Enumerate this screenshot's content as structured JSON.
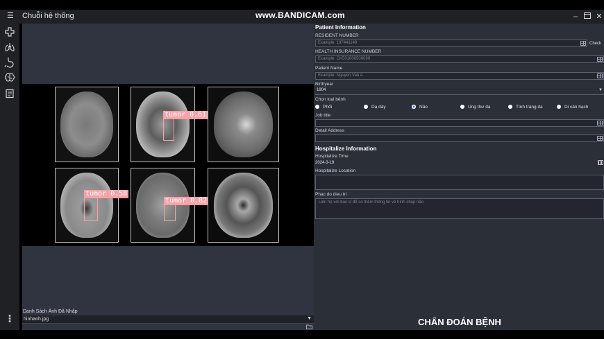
{
  "app": {
    "title": "Chuỗi hệ thống",
    "watermark": "www.BANDICAM.com",
    "window_controls": [
      "minimize",
      "maximize",
      "close"
    ]
  },
  "sidebar": {
    "icons": [
      "add-icon",
      "lungs-icon",
      "stomach-icon",
      "brain-icon",
      "document-icon"
    ],
    "more_icon": "more-vertical-icon"
  },
  "left_panel": {
    "detections": [
      {
        "label": "tumor  0.61"
      },
      {
        "label": "tumor  0.58"
      },
      {
        "label": "tumor  0.82"
      }
    ],
    "image_list_label": "Danh Sách Ảnh Đã Nhập",
    "selected_image": "hinhanh.jpg"
  },
  "patient_info": {
    "section_title": "Patient Information",
    "resident_number": {
      "label": "RESIDENT NUMBER",
      "placeholder": "Example: 197441149"
    },
    "check_label": "Check",
    "insurance_number": {
      "label": "HEALTH INSURANCE NUMBER",
      "placeholder": "Example: CK501000500099"
    },
    "patient_name": {
      "label": "Patient Name",
      "placeholder": "Example: Nguyen Van A"
    },
    "birthyear": {
      "label": "Birthyear",
      "value": "1904"
    },
    "disease_type": {
      "label": "Chọn loại bệnh",
      "options": [
        "Phổi",
        "Dạ dày",
        "Não",
        "Ung thư da",
        "Tình trạng da",
        "Di căn hạch"
      ],
      "selected": "Não"
    },
    "job_title": {
      "label": "Job title",
      "value": ""
    },
    "detail_address": {
      "label": "Detail Address",
      "value": ""
    }
  },
  "hospitalize_info": {
    "section_title": "Hospitalize Information",
    "time": {
      "label": "Hospitalize Time",
      "value": "2024-3-19"
    },
    "location": {
      "label": "Hospitalize Location",
      "value": ""
    },
    "treatment": {
      "label": "Phac do dieu tri",
      "placeholder": "Liên hệ với bác sĩ để có thêm thông tin về hình chụp não"
    }
  },
  "diagnose_button": "CHẨN ĐOÁN BỆNH"
}
